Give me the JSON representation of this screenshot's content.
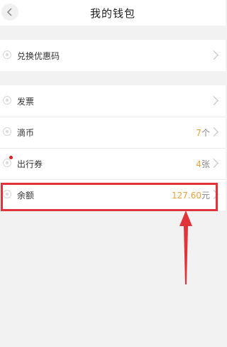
{
  "header": {
    "title": "我的钱包"
  },
  "group1": [
    {
      "label": "兑换优惠码"
    }
  ],
  "group2": [
    {
      "label": "发票",
      "value": "",
      "unit": ""
    },
    {
      "label": "滴币",
      "value": "7",
      "unit": "个"
    },
    {
      "label": "出行券",
      "value": "4",
      "unit": "张"
    },
    {
      "label": "余额",
      "value": "127.60",
      "unit": "元"
    }
  ],
  "colors": {
    "accent": "#e9a23b",
    "highlight": "#e0343a",
    "badge": "#e02020"
  },
  "icons": [
    "back-icon",
    "coupon-icon",
    "invoice-icon",
    "coin-icon",
    "ticket-icon",
    "balance-icon",
    "chevron-right-icon"
  ]
}
